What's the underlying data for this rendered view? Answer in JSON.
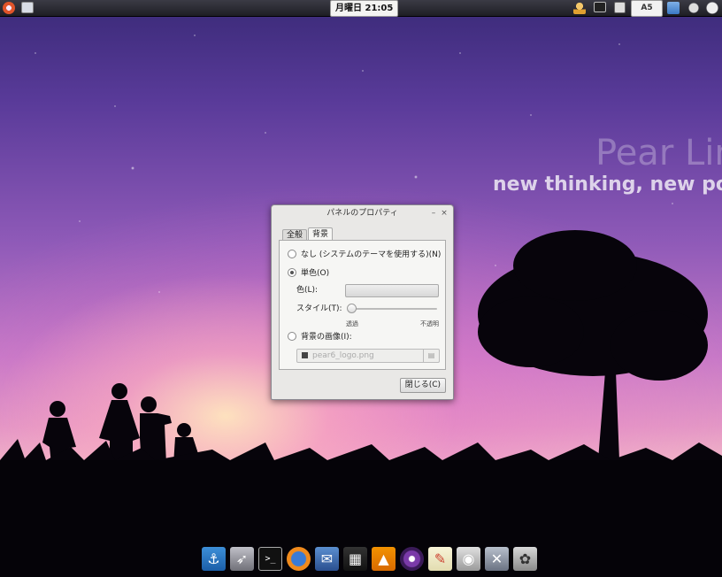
{
  "top_panel": {
    "clock": "月曜日 21:05",
    "keyboard_indicator": "A5"
  },
  "wallpaper": {
    "title": "Pear Lin",
    "tagline": "new thinking, new pos"
  },
  "dialog": {
    "title": "パネルのプロパティ",
    "minimize": "–",
    "close": "×",
    "tabs": [
      {
        "label": "全般"
      },
      {
        "label": "背景"
      }
    ],
    "active_tab": "背景",
    "options": {
      "none_label": "なし (システムのテーマを使用する)(N)",
      "solid_label": "単色(O)",
      "color_label": "色(L):",
      "style_label": "スタイル(T):",
      "style_value": 0,
      "slider_min": "透過",
      "slider_max": "不透明",
      "image_label": "背景の画像(I):",
      "file_name": "pear6_logo.png",
      "selected": "solid"
    },
    "close_button": "閉じる(C)"
  },
  "dock": {
    "items": [
      "anchor-icon",
      "rocket-icon",
      "terminal-icon",
      "firefox-icon",
      "mail-icon",
      "video-editor-icon",
      "vlc-icon",
      "eye-icon",
      "notes-icon",
      "camera-icon",
      "tools-icon",
      "gimp-icon"
    ]
  }
}
